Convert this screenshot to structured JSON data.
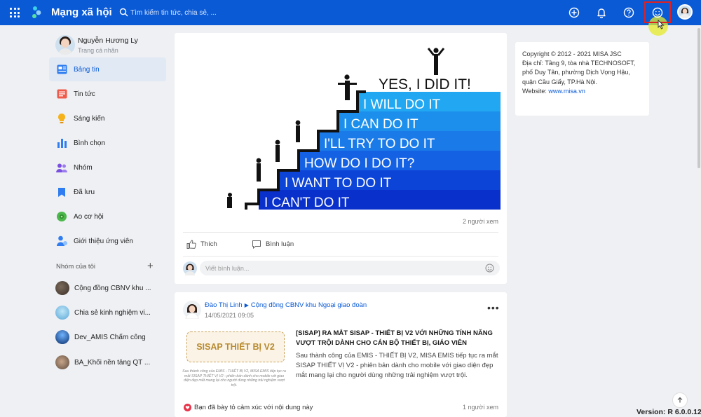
{
  "topbar": {
    "brand": "Mạng xã hội",
    "search_placeholder": "Tìm kiếm tin tức, chia sẻ, ...",
    "icons": [
      "apps-grid-icon",
      "logo-icon",
      "search-icon",
      "add-circle-icon",
      "bell-icon",
      "help-icon",
      "emoji-icon",
      "user-avatar"
    ]
  },
  "profile": {
    "name": "Nguyễn Hương Ly",
    "subtitle": "Trang cá nhân"
  },
  "nav": {
    "items": [
      {
        "label": "Bảng tin",
        "icon": "newsfeed-icon",
        "active": true
      },
      {
        "label": "Tin tức",
        "icon": "news-icon"
      },
      {
        "label": "Sáng kiến",
        "icon": "lightbulb-icon"
      },
      {
        "label": "Bình chọn",
        "icon": "poll-icon"
      },
      {
        "label": "Nhóm",
        "icon": "group-icon"
      },
      {
        "label": "Đã lưu",
        "icon": "bookmark-icon"
      },
      {
        "label": "Ao cơ hội",
        "icon": "opportunity-icon"
      },
      {
        "label": "Giới thiệu ứng viên",
        "icon": "candidate-icon"
      }
    ]
  },
  "groups": {
    "title": "Nhóm của tôi",
    "add_symbol": "+",
    "items": [
      {
        "label": "Cộng đồng CBNV khu ..."
      },
      {
        "label": "Chia sẻ kinh nghiệm vi..."
      },
      {
        "label": "Dev_AMIS Chấm công"
      },
      {
        "label": "BA_Khối nền tảng QT ..."
      }
    ]
  },
  "post1": {
    "image_text": {
      "top": "YES, I DID IT!",
      "steps": [
        "I WILL DO IT",
        "I CAN DO IT",
        "I'LL TRY TO DO IT",
        "HOW DO I DO IT?",
        "I WANT TO DO IT",
        "I CAN'T DO IT"
      ]
    },
    "views": "2 người xem",
    "like": "Thích",
    "comment": "Bình luận",
    "comment_placeholder": "Viết bình luận..."
  },
  "post2": {
    "author": "Đào Thị Linh",
    "arrow": "▶",
    "group": "Cộng đồng CBNV khu Ngoại giao đoàn",
    "date": "14/05/2021 09:05",
    "more": "•••",
    "banner": "SISAP THIẾT BỊ V2",
    "thumb_text": "Sau thành công của EMIS - THIẾT BỊ V2, MISA EMIS tiếp tục ra mắt SISAP THIẾT VỊ V2 - phiên bản dành cho mobile với giao diện đẹp mắt mang lại cho người dùng những trải nghiệm vượt trội.",
    "title": "[SISAP] RA MẮT SISAP - THIẾT BỊ V2 VỚI NHỮNG TÍNH NĂNG VƯỢT TRỘI DÀNH CHO CÁN BỘ THIẾT BỊ, GIÁO VIÊN",
    "description": "Sau thành công của EMIS - THIẾT BỊ V2, MISA EMIS tiếp tục ra mắt SISAP THIẾT VỊ V2 - phiên bản dành cho mobile với giao diện đẹp mắt mang lại cho người dùng những trải nghiệm vượt trội.",
    "reaction_text": "Bạn đã bày tỏ cảm xúc với nội dung này",
    "views": "1 người xem"
  },
  "copyright": {
    "line1": "Copyright © 2012 - 2021 MISA JSC",
    "line2": "Địa chỉ: Tầng 9, tòa nhà TECHNOSOFT,",
    "line3": "phố Duy Tân, phường Dịch Vọng Hậu,",
    "line4": "quận Cầu Giấy, TP.Hà Nội.",
    "website_label": "Website: ",
    "website": "www.misa.vn"
  },
  "footer": {
    "version": "Version: R 6.0.0.12"
  },
  "colors": {
    "topbar": "#0a5ad6",
    "accent": "#0a5ad6",
    "highlight": "#e02020",
    "background": "#eef0f3"
  }
}
